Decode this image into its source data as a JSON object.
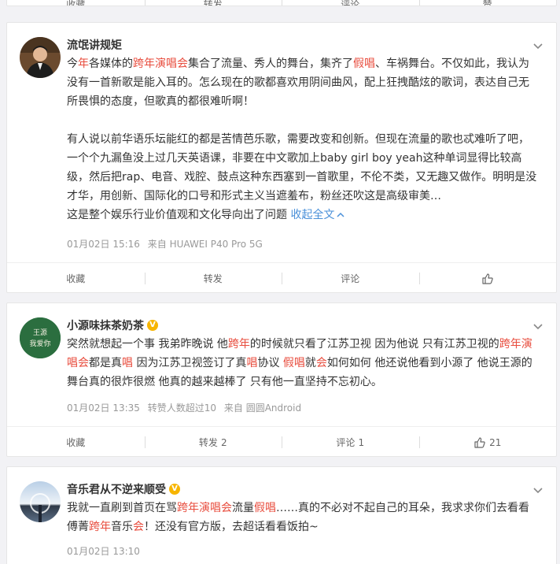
{
  "top_strip": {
    "labels": [
      "收藏",
      "转发",
      "评论",
      "赞"
    ]
  },
  "posts": [
    {
      "username": "流氓讲规矩",
      "paragraphs": [
        [
          {
            "t": "今",
            "h": false
          },
          {
            "t": "年",
            "h": true
          },
          {
            "t": "各媒体的",
            "h": false
          },
          {
            "t": "跨年演唱会",
            "h": true
          },
          {
            "t": "集合了流量、秀人的舞台，集齐了",
            "h": false
          },
          {
            "t": "假唱",
            "h": true
          },
          {
            "t": "、车祸舞台。不仅如此，我认为没有一首新歌是能入耳的。怎么现在的歌都喜欢用阴间曲风，配上狂拽酷炫的歌词，表达自己无所畏惧的态度，但歌真的都很难听啊！",
            "h": false
          }
        ],
        [
          {
            "t": "有人说以前华语乐坛能红的都是苦情芭乐歌，需要改变和创新。但现在流量的歌也忒难听了吧，一个个九漏鱼没上过几天英语课，非要在中文歌加上baby girl boy yeah这种单词显得比较高级，然后把rap、电音、戏腔、鼓点这种东西塞到一首歌里，不伦不类，又无趣又做作。明明是没才华，用创新、国际化的口号和形式主义当遮羞布，粉丝还吹这是高级审美…",
            "h": false
          }
        ],
        [
          {
            "t": "这是整个娱乐行业价值观和文化导向出了问题 ",
            "h": false
          }
        ]
      ],
      "collapse_label": "收起全文",
      "time": "01月02日 15:16",
      "source": "来自 HUAWEI P40 Pro 5G",
      "actions": {
        "fav": "收藏",
        "repost": "转发",
        "repost_count": "",
        "comment": "评论",
        "comment_count": "",
        "like_count": ""
      }
    },
    {
      "username": "小源味抹茶奶茶",
      "avatar_text": [
        "王源",
        "我爱你"
      ],
      "paragraphs": [
        [
          {
            "t": "突然就想起一个事 我弟昨晚说 他",
            "h": false
          },
          {
            "t": "跨年",
            "h": true
          },
          {
            "t": "的时候就只看了江苏卫视 因为他说 只有江苏卫视的",
            "h": false
          },
          {
            "t": "跨年演唱会",
            "h": true
          },
          {
            "t": "都是真",
            "h": false
          },
          {
            "t": "唱",
            "h": true
          },
          {
            "t": " 因为江苏卫视签订了真",
            "h": false
          },
          {
            "t": "唱",
            "h": true
          },
          {
            "t": "协议 ",
            "h": false
          },
          {
            "t": "假唱",
            "h": true
          },
          {
            "t": "就",
            "h": false
          },
          {
            "t": "会",
            "h": true
          },
          {
            "t": "如何如何 他还说他看到小源了 他说王源的舞台真的很炸很燃 他真的越来越棒了 只有他一直坚持不忘初心。",
            "h": false
          }
        ]
      ],
      "time": "01月02日 13:35",
      "extra": "转赞人数超过10",
      "source": "来自 圆圆Android",
      "actions": {
        "fav": "收藏",
        "repost": "转发",
        "repost_count": "2",
        "comment": "评论",
        "comment_count": "1",
        "like_count": "21"
      }
    },
    {
      "username": "音乐君从不逆来顺受",
      "paragraphs": [
        [
          {
            "t": "我就一直刷到首页在骂",
            "h": false
          },
          {
            "t": "跨年演唱会",
            "h": true
          },
          {
            "t": "流量",
            "h": false
          },
          {
            "t": "假唱",
            "h": true
          },
          {
            "t": "……真的不必对不起自己的耳朵，我求求你们去看看傅菁",
            "h": false
          },
          {
            "t": "跨年",
            "h": true
          },
          {
            "t": "音乐",
            "h": false
          },
          {
            "t": "会",
            "h": true
          },
          {
            "t": "！还没有官方版，去超话看看饭拍~",
            "h": false
          }
        ]
      ],
      "time": "01月02日 13:10"
    }
  ],
  "colors": {
    "highlight": "#e84c3d",
    "link": "#4a90d9",
    "vip": "#f7b500"
  }
}
